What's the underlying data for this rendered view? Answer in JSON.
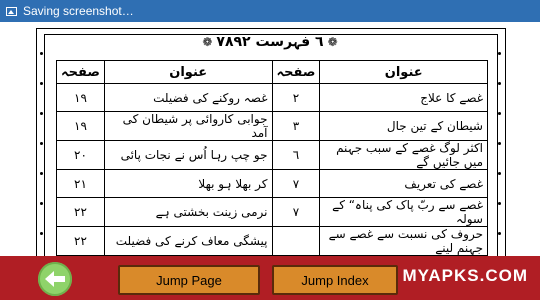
{
  "status_bar": {
    "text": "Saving screenshot…"
  },
  "header": {
    "title": "۷۸٦ فہرست ۹۲"
  },
  "table": {
    "headers": {
      "page_right": "صفحہ",
      "title_right": "عنوان",
      "page_left": "صفحہ",
      "title_left": "عنوان"
    },
    "rows": [
      {
        "right_title": "غصے کا علاج",
        "right_page": "۲",
        "left_title": "غصہ روکنے کی فضیلت",
        "left_page": "۱۹"
      },
      {
        "right_title": "شیطان کے تین جال",
        "right_page": "۳",
        "left_title": "جوابی کاروائی پر شیطان کی آمد",
        "left_page": "۱۹"
      },
      {
        "right_title": "اکثر لوگ غصے کے سبب جہنم میں جائیں گے",
        "right_page": "٦",
        "left_title": "جو چپ رہا اُس نے نجات پائی",
        "left_page": "۲۰"
      },
      {
        "right_title": "غصے کی تعریف",
        "right_page": "۷",
        "left_title": "کر بھلا ہو بھلا",
        "left_page": "۲۱"
      },
      {
        "right_title": "غصے سے ربّ پاک کی پناہ“ کے سولہ",
        "right_page": "۷",
        "left_title": "نرمی زینت بخشتی ہے",
        "left_page": "۲۲"
      },
      {
        "right_title": "حروف کی نسبت سے غصے سے جہنم لینے",
        "right_page": "",
        "left_title": "پیشگی معاف کرنے کی فضیلت",
        "left_page": "۲۲"
      }
    ]
  },
  "bottom_bar": {
    "back_icon": "left-arrow-icon",
    "jump_page_label": "Jump Page",
    "jump_index_label": "Jump Index",
    "watermark": "MYAPKS.COM"
  }
}
